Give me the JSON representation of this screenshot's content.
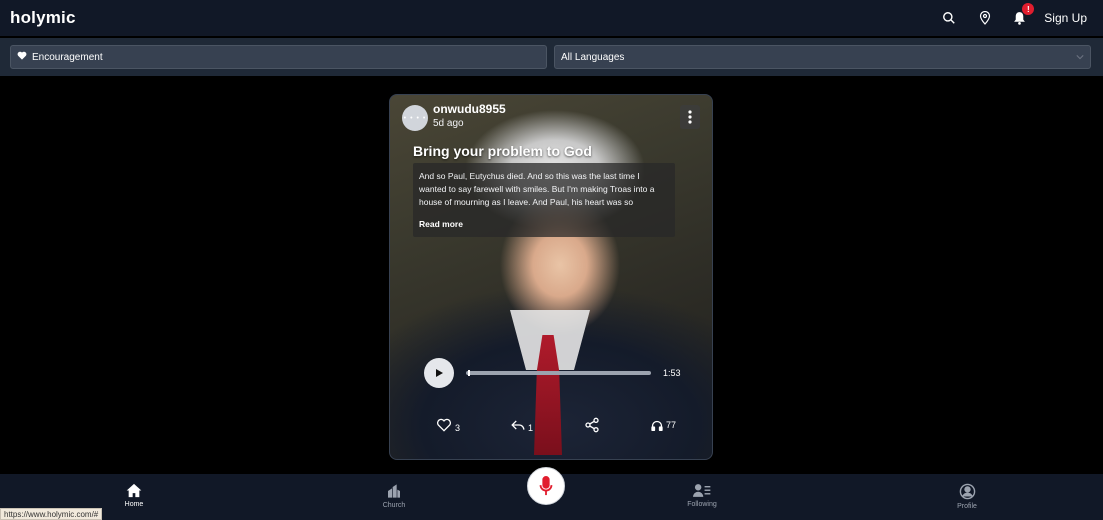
{
  "header": {
    "logo": "holymic",
    "notification_count": "!",
    "signup_label": "Sign Up"
  },
  "filters": {
    "category": "Encouragement",
    "language": "All Languages"
  },
  "post": {
    "avatar_text": "• • • •",
    "username": "onwudu8955",
    "time_ago": "5d ago",
    "title": "Bring your problem to God",
    "excerpt": "And so Paul, Eutychus died. And so this was the last time I wanted to say farewell with smiles. But I'm making Troas into a house of mourning as I leave. And Paul, his heart was so",
    "read_more": "Read more",
    "duration": "1:53",
    "progress": 0.01,
    "likes": "3",
    "replies": "1",
    "listens": "77"
  },
  "nav": {
    "home": "Home",
    "church": "Church",
    "following": "Following",
    "profile": "Profile"
  },
  "status_url": "https://www.holymic.com/#",
  "colors": {
    "accent": "#e11d2e",
    "bar_bg": "#111827",
    "filter_bg": "#374151"
  }
}
